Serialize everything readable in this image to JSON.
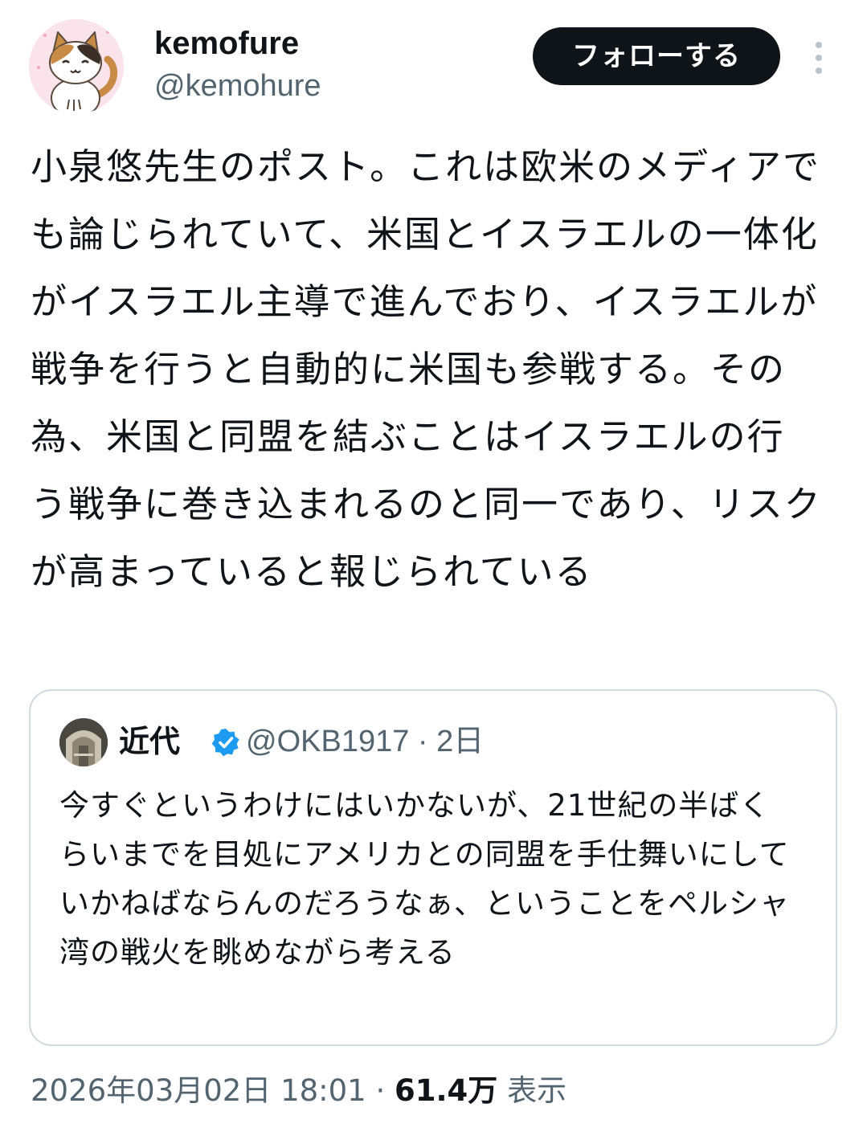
{
  "author": {
    "display_name": "kemofure",
    "handle": "@kemohure",
    "avatar_icon": "calico-cat-avatar-icon"
  },
  "actions": {
    "follow_label": "フォローする",
    "more_icon": "more-vertical-icon"
  },
  "post": {
    "text": "小泉悠先生のポスト。これは欧米のメディアでも論じられていて、米国とイスラエルの一体化がイスラエル主導で進んでおり、イスラエルが戦争を行うと自動的に米国も参戦する。その為、米国と同盟を結ぶことはイスラエルの行う戦争に巻き込まれるのと同一であり、リスクが高まっていると報じられている"
  },
  "quote": {
    "display_name": "近代",
    "handle": "@OKB1917",
    "separator": "·",
    "age": "2日",
    "verified_icon": "verified-badge-icon",
    "text": "今すぐというわけにはいかないが、21世紀の半ばくらいまでを目処にアメリカとの同盟を手仕舞いにしていかねばならんのだろうなぁ、ということをペルシャ湾の戦火を眺めながら考える"
  },
  "meta": {
    "timestamp": "2026年03月02日 18:01",
    "separator": "·",
    "views_count": "61.4万",
    "views_label": "表示"
  },
  "colors": {
    "text_primary": "#0f1419",
    "text_secondary": "#536471",
    "button_bg": "#0f1419",
    "verified_blue": "#1d9bf0",
    "border": "#cfd9de"
  }
}
